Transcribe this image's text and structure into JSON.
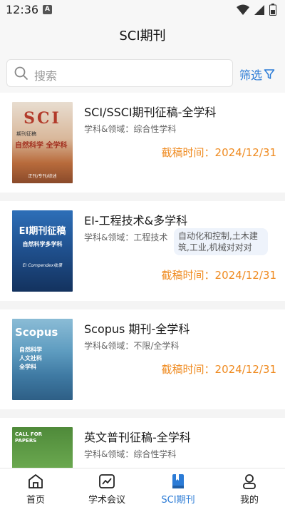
{
  "status": {
    "time": "12:36",
    "notif_letter": "A"
  },
  "header": {
    "title": "SCI期刊"
  },
  "search": {
    "placeholder": "搜索",
    "filter_label": "筛选"
  },
  "journals": [
    {
      "title": "SCI/SSCI期刊征稿-全学科",
      "field": "学科&领域：综合性学科",
      "tag": "",
      "deadline": "截稿时间：2024/12/31",
      "cover": {
        "big": "SCI",
        "line1": "期刊征稿",
        "line2": "自然科学 全学科",
        "footer": "正刊/专刊/综述"
      }
    },
    {
      "title": "EI-工程技术&多学科",
      "field": "学科&领域：工程技术",
      "tag": "自动化和控制,土木建筑,工业,机械对对对",
      "deadline": "截稿时间：2024/12/31",
      "cover": {
        "big": "EI期刊征稿",
        "line1": "自然科学多学科",
        "line2": "EI Compendex收录",
        "footer": ""
      }
    },
    {
      "title": "Scopus 期刊-全学科",
      "field": "学科&领域：不限/全学科",
      "tag": "",
      "deadline": "截稿时间：2024/12/31",
      "cover": {
        "big": "Scopus",
        "line1": "自然科学",
        "line2": "人文社科",
        "footer": "全学科"
      }
    },
    {
      "title": "英文普刊征稿-全学科",
      "field": "学科&领域：综合性学科",
      "tag": "",
      "deadline": "",
      "cover": {
        "big": "CALL FOR PAPERS",
        "line1": "",
        "line2": "",
        "footer": ""
      }
    }
  ],
  "tabs": [
    {
      "label": "首页",
      "icon": "home-icon",
      "active": false
    },
    {
      "label": "学术会议",
      "icon": "chart-icon",
      "active": false
    },
    {
      "label": "SCI期刊",
      "icon": "book-icon",
      "active": true
    },
    {
      "label": "我的",
      "icon": "person-icon",
      "active": false
    }
  ],
  "colors": {
    "accent": "#2b7bd6",
    "deadline": "#ef8a1f"
  }
}
